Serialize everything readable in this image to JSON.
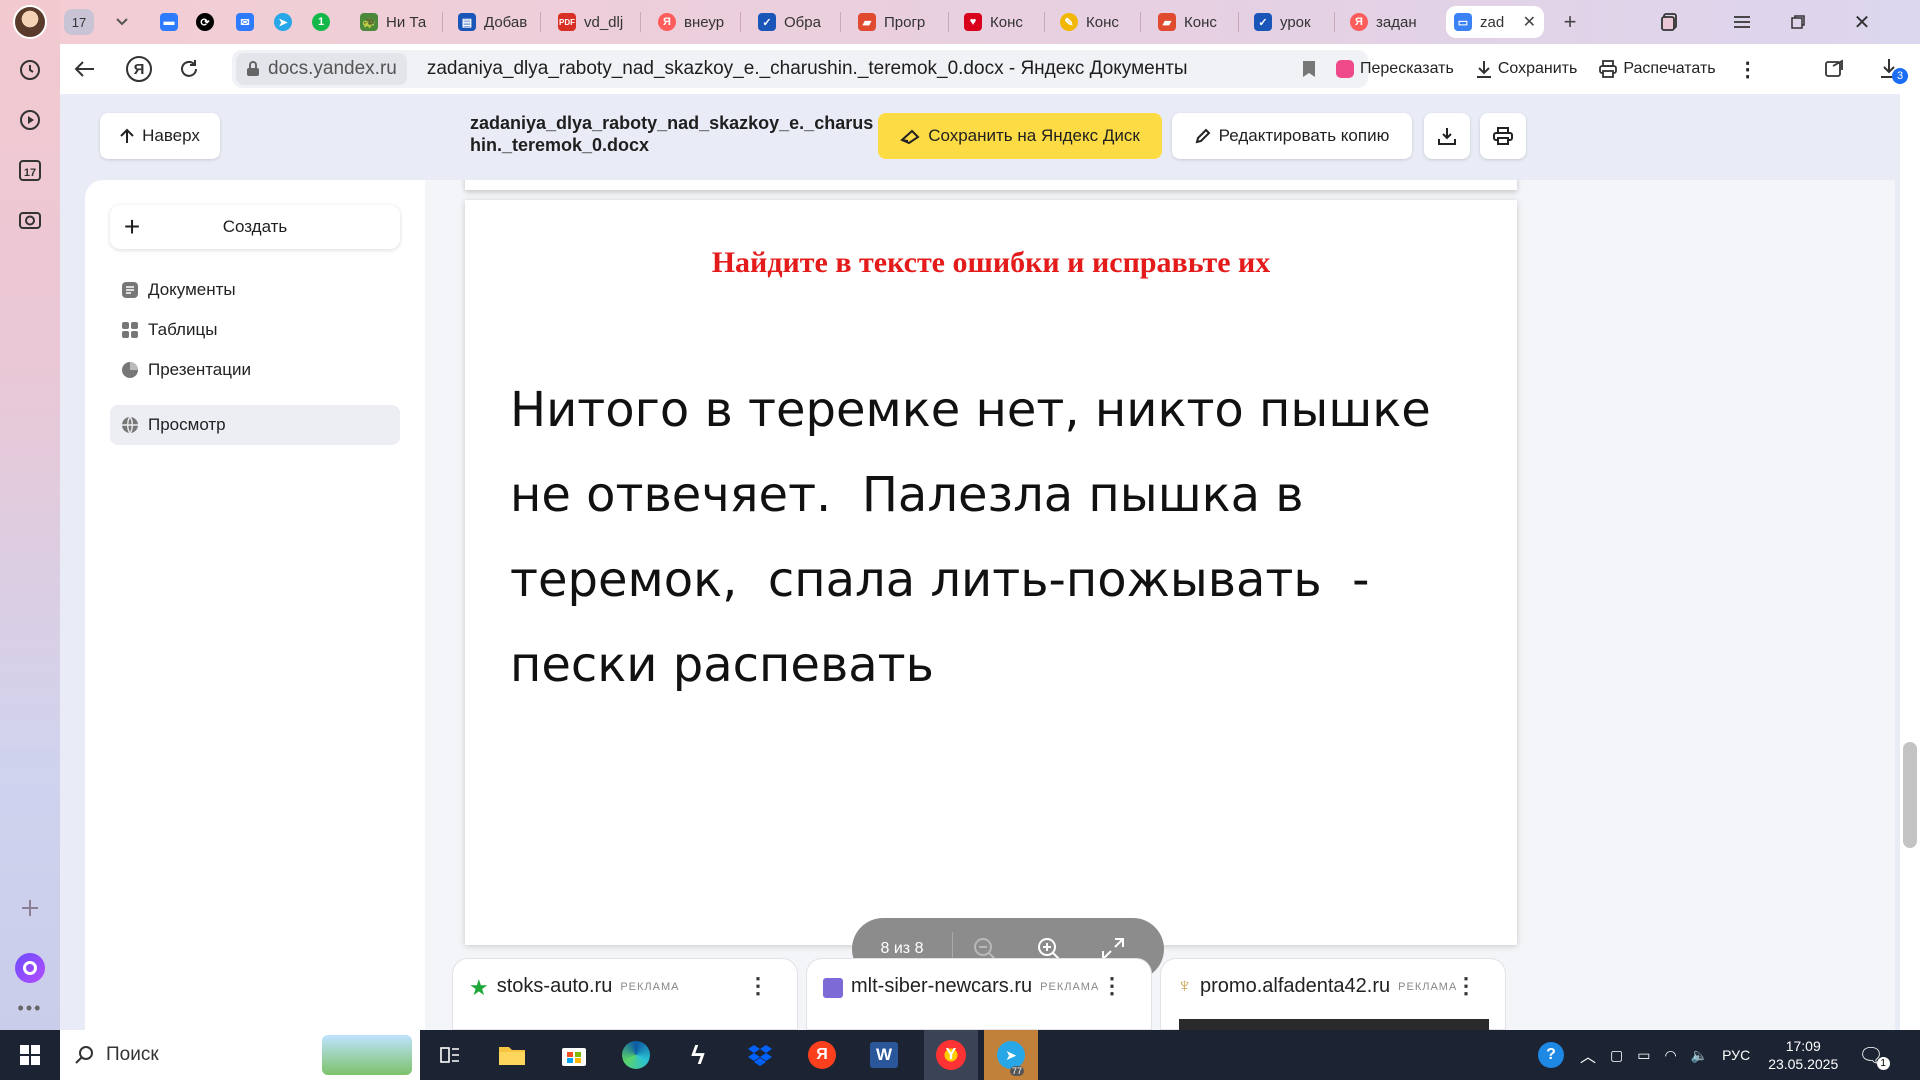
{
  "browser_sidebar": {
    "calendar_day": "17"
  },
  "tabs": [
    {
      "label": "17",
      "color": "#c9c3d6"
    },
    {
      "label": "",
      "color": "#2f7bff"
    },
    {
      "label": "",
      "color": "#000000"
    },
    {
      "label": "",
      "color": "#2f7bff"
    },
    {
      "label": "",
      "color": "#27a7e7"
    },
    {
      "label": "",
      "color": "#14b84a"
    },
    {
      "label": "Ни Та",
      "color": "#4a8a3a"
    },
    {
      "label": "Добав",
      "color": "#1a56b8"
    },
    {
      "label": "vd_dlj",
      "color": "#d93025"
    },
    {
      "label": "внеур",
      "color": "#ff5c5c"
    },
    {
      "label": "Обра",
      "color": "#1a56b8"
    },
    {
      "label": "Прогр",
      "color": "#e04a2f"
    },
    {
      "label": "Конс",
      "color": "#d9001b"
    },
    {
      "label": "Конс",
      "color": "#f2b705"
    },
    {
      "label": "Конс",
      "color": "#e04a2f"
    },
    {
      "label": "урок",
      "color": "#1a56b8"
    },
    {
      "label": "задан",
      "color": "#ff5c5c"
    },
    {
      "label": "zad",
      "color": "#3b82f6"
    }
  ],
  "address": {
    "domain": "docs.yandex.ru",
    "title": "zadaniya_dlya_raboty_nad_skazkoy_e._charushin._teremok_0.docx - Яндекс Документы",
    "retell": "Пересказать",
    "save": "Сохранить",
    "print": "Распечатать",
    "downloads_count": "3"
  },
  "doc_header": {
    "up": "Наверх",
    "filename": "zadaniya_dlya_raboty_nad_skazkoy_e._charushin._teremok_0.docx",
    "save_disk": "Сохранить на Яндекс Диск",
    "edit_copy": "Редактировать копию"
  },
  "sidebar": {
    "create": "Создать",
    "items": [
      {
        "label": "Документы"
      },
      {
        "label": "Таблицы"
      },
      {
        "label": "Презентации"
      },
      {
        "label": "Просмотр"
      }
    ]
  },
  "page": {
    "heading": "Найдите в тексте ошибки и исправьте их",
    "body": "Нитого в теремке нет, никто пышке не отвечяет.  Палезла пышка в теремок,  спала лить-пожывать  - пески распевать"
  },
  "pager": {
    "counter": "8 из 8"
  },
  "ads": [
    {
      "domain": "stoks-auto.ru",
      "tag": "РЕКЛАМА"
    },
    {
      "domain": "mlt-siber-newcars.ru",
      "tag": "РЕКЛАМА"
    },
    {
      "domain": "promo.alfadenta42.ru",
      "tag": "РЕКЛАМА"
    }
  ],
  "taskbar": {
    "search": "Поиск",
    "lang": "РУС",
    "time": "17:09",
    "date": "23.05.2025",
    "telegram_badge": "77",
    "notif_count": "1"
  },
  "colors": {
    "accent_yellow": "#fcdb44",
    "heading_red": "#e31b1b",
    "taskbar": "#1c2433"
  }
}
